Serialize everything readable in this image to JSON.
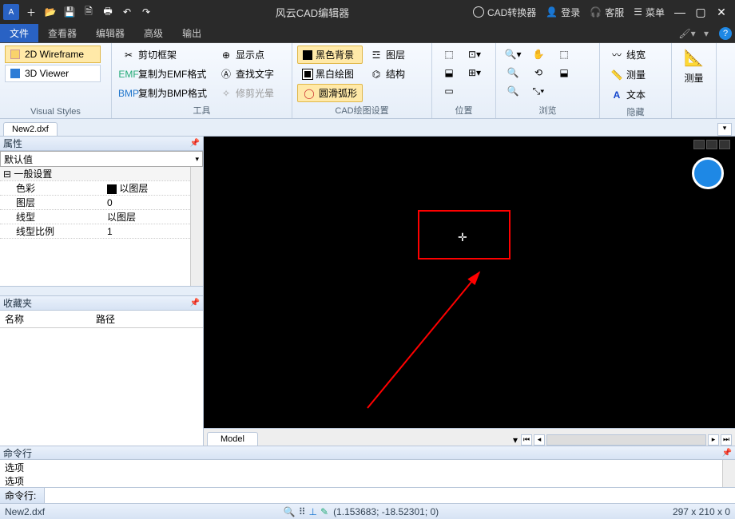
{
  "titlebar": {
    "title": "风云CAD编辑器",
    "right": {
      "converter": "CAD转换器",
      "login": "登录",
      "service": "客服",
      "menu": "菜单"
    }
  },
  "menu": {
    "file": "文件",
    "viewer": "查看器",
    "editor": "编辑器",
    "advanced": "高级",
    "output": "输出"
  },
  "ribbon": {
    "visual_styles": {
      "wireframe": "2D Wireframe",
      "viewer3d": "3D Viewer",
      "label": "Visual Styles"
    },
    "tools": {
      "clip_frame": "剪切框架",
      "copy_emf": "复制为EMF格式",
      "copy_bmp": "复制为BMP格式",
      "show_point": "显示点",
      "find_text": "查找文字",
      "trim_halo": "修剪光晕",
      "label": "工具"
    },
    "cad_settings": {
      "black_bg": "黑色背景",
      "bw_draw": "黑白绘图",
      "smooth_arc": "圆滑弧形",
      "layers": "图层",
      "structure": "结构",
      "label": "CAD绘图设置"
    },
    "position": {
      "label": "位置"
    },
    "browse": {
      "label": "浏览"
    },
    "hide": {
      "line_width": "线宽",
      "measure": "测量",
      "text": "文本",
      "label": "隐藏"
    },
    "measure_group": {
      "measure": "测量"
    }
  },
  "file_tab": "New2.dxf",
  "props": {
    "title": "属性",
    "default": "默认值",
    "section_general": "一般设置",
    "rows": {
      "color": {
        "k": "色彩",
        "v": "以图层"
      },
      "layer": {
        "k": "图层",
        "v": "0"
      },
      "linetype": {
        "k": "线型",
        "v": "以图层"
      },
      "lt_scale": {
        "k": "线型比例",
        "v": "1"
      }
    }
  },
  "fav": {
    "title": "收藏夹",
    "col_name": "名称",
    "col_path": "路径"
  },
  "model": {
    "tab": "Model"
  },
  "cmd": {
    "title": "命令行",
    "log1": "选项",
    "log2": "选项",
    "label": "命令行:"
  },
  "status": {
    "file": "New2.dxf",
    "coords": "(1.153683; -18.52301; 0)",
    "dims": "297 x 210 x 0"
  }
}
